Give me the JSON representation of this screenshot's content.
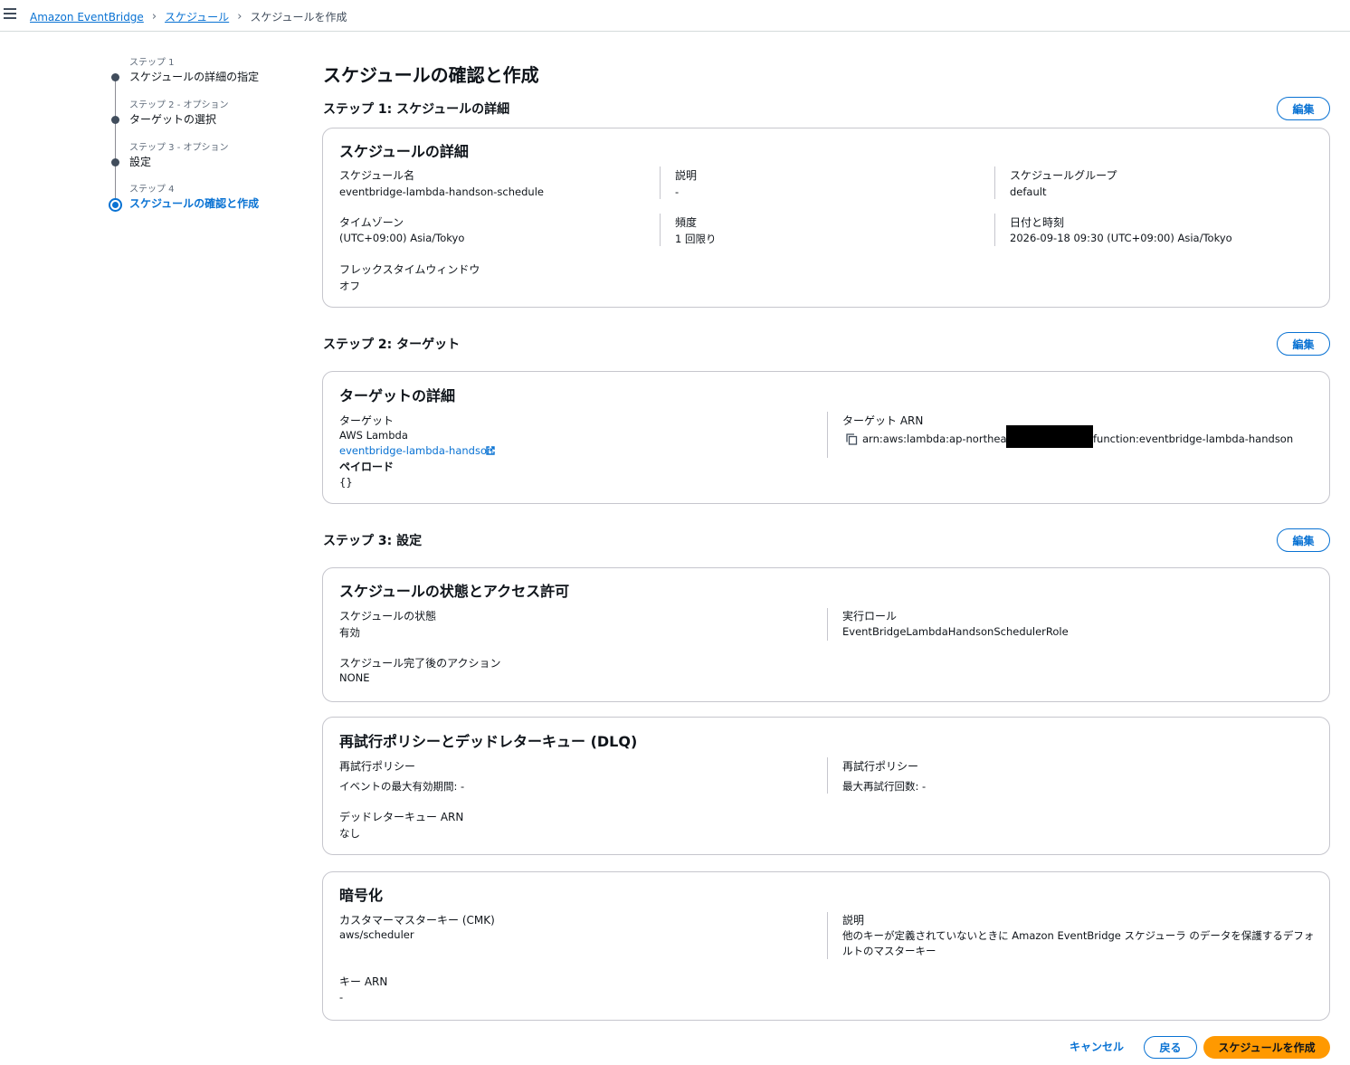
{
  "breadcrumb": {
    "items": [
      "Amazon EventBridge",
      "スケジュール"
    ],
    "current": "スケジュールを作成"
  },
  "wizard": {
    "steps": [
      {
        "number": "ステップ 1",
        "title": "スケジュールの詳細の指定"
      },
      {
        "number": "ステップ 2 - オプション",
        "title": "ターゲットの選択"
      },
      {
        "number": "ステップ 3 - オプション",
        "title": "設定"
      },
      {
        "number": "ステップ 4",
        "title": "スケジュールの確認と作成"
      }
    ],
    "active_step": 4
  },
  "page_title": "スケジュールの確認と作成",
  "edit_label": "編集",
  "step1": {
    "heading": "ステップ 1: スケジュールの詳細",
    "card_title": "スケジュールの詳細",
    "schedule_name_label": "スケジュール名",
    "schedule_name": "eventbridge-lambda-handson-schedule",
    "description_label": "説明",
    "description": "-",
    "group_label": "スケジュールグループ",
    "group": "default",
    "timezone_label": "タイムゾーン",
    "timezone": "(UTC+09:00) Asia/Tokyo",
    "frequency_label": "頻度",
    "frequency": "1 回限り",
    "datetime_label": "日付と時刻",
    "datetime": "2026-09-18 09:30 (UTC+09:00) Asia/Tokyo",
    "flex_label": "フレックスタイムウィンドウ",
    "flex": "オフ"
  },
  "step2": {
    "heading": "ステップ 2: ターゲット",
    "card_title": "ターゲットの詳細",
    "target_label": "ターゲット",
    "target_type": "AWS Lambda",
    "target_function": "eventbridge-lambda-handson",
    "payload_label": "ペイロード",
    "payload": "{}",
    "arn_label": "ターゲット ARN",
    "arn_prefix": "arn:aws:lambda:ap-northeast-",
    "arn_suffix": "function:eventbridge-lambda-handson"
  },
  "step3": {
    "heading": "ステップ 3: 設定",
    "state_card": {
      "title": "スケジュールの状態とアクセス許可",
      "state_label": "スケジュールの状態",
      "state": "有効",
      "role_label": "実行ロール",
      "role": "EventBridgeLambdaHandsonSchedulerRole",
      "after_label": "スケジュール完了後のアクション",
      "after": "NONE"
    },
    "retry_card": {
      "title": "再試行ポリシーとデッドレターキュー (DLQ)",
      "policy_label_left": "再試行ポリシー",
      "max_age": "イベントの最大有効期間: -",
      "policy_label_right": "再試行ポリシー",
      "max_retries": "最大再試行回数: -",
      "dlq_label": "デッドレターキュー ARN",
      "dlq": "なし"
    },
    "encryption_card": {
      "title": "暗号化",
      "cmk_label": "カスタマーマスターキー (CMK)",
      "cmk": "aws/scheduler",
      "desc_label": "説明",
      "desc_line1": "他のキーが定義されていないときに Amazon EventBridge スケジューラ のデータを保護するデフォ",
      "desc_line2": "ルトのマスターキー",
      "key_arn_label": "キー ARN",
      "key_arn": "-"
    }
  },
  "footer": {
    "cancel": "キャンセル",
    "back": "戻る",
    "create": "スケジュールを作成"
  },
  "colors": {
    "link": "#0972d3",
    "primary_button": "#ff9900",
    "text": "#0f141a"
  }
}
